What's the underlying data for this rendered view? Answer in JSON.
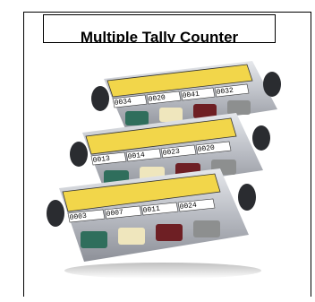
{
  "title": "Multiple Tally Counter",
  "counters": {
    "top": [
      "0034",
      "0020",
      "0041",
      "0032"
    ],
    "middle": [
      "0013",
      "0014",
      "0023",
      "0020"
    ],
    "bottom": [
      "0003",
      "0007",
      "0011",
      "0024"
    ]
  },
  "colors": {
    "label_yellow": "#f2d64a",
    "key_green": "#2f6e5c",
    "key_cream": "#efe6bd",
    "key_red": "#6e1f24",
    "key_gray": "#8d8f8f",
    "body_silver": "#c9ccd2"
  }
}
